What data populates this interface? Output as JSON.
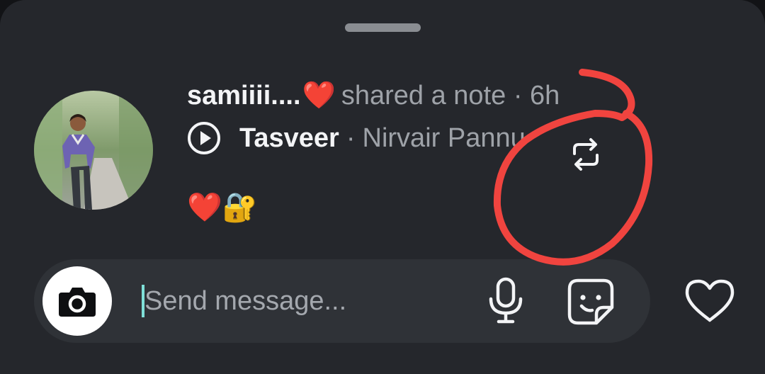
{
  "note": {
    "username": "samiiii....",
    "username_emoji": "❤️",
    "action_text": "shared a note · 6h",
    "song_title": "Tasveer",
    "separator": "·",
    "artist": "Nirvair Pannu",
    "note_text": "❤️🔐",
    "icons": {
      "play": "play-circle-icon",
      "repost": "repost-icon"
    }
  },
  "composer": {
    "placeholder": "Send message...",
    "icons": {
      "camera": "camera-icon",
      "mic": "microphone-icon",
      "sticker": "sticker-icon",
      "like": "heart-icon"
    }
  },
  "annotation": {
    "color": "#f0443f"
  },
  "colors": {
    "sheet": "#25272c",
    "composer": "#2f3237",
    "text_primary": "#f3f4f6",
    "text_secondary": "#9ea2a8",
    "caret": "#7fe0d8"
  }
}
